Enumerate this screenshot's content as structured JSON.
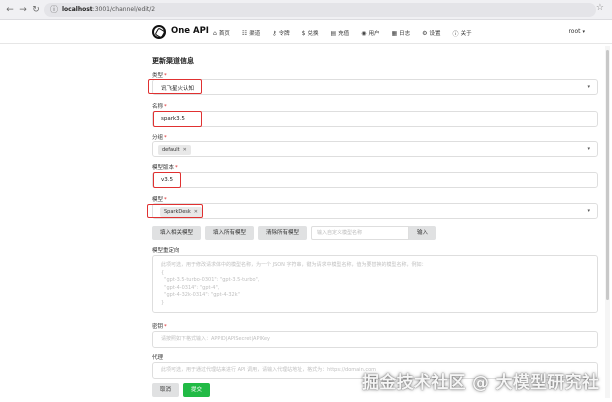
{
  "browser": {
    "url_host": "localhost",
    "url_path": ":3001/channel/edit/2"
  },
  "header": {
    "brand": "One API",
    "menu": [
      {
        "icon": "home-icon",
        "glyph": "⌂",
        "label": "首页"
      },
      {
        "icon": "channel-icon",
        "glyph": "☷",
        "label": "渠道"
      },
      {
        "icon": "token-icon",
        "glyph": "⚷",
        "label": "令牌"
      },
      {
        "icon": "redeem-icon",
        "glyph": "$",
        "label": "兑换"
      },
      {
        "icon": "topup-icon",
        "glyph": "▤",
        "label": "充值"
      },
      {
        "icon": "user-icon",
        "glyph": "◉",
        "label": "用户"
      },
      {
        "icon": "log-icon",
        "glyph": "▦",
        "label": "日志"
      },
      {
        "icon": "settings-icon",
        "glyph": "⚙",
        "label": "设置"
      },
      {
        "icon": "about-icon",
        "glyph": "ⓘ",
        "label": "关于"
      }
    ],
    "user": "root"
  },
  "form": {
    "title": "更新渠道信息",
    "type": {
      "label": "类型",
      "value": "讯飞星火认知"
    },
    "name": {
      "label": "名称",
      "value": "spark3.5"
    },
    "group": {
      "label": "分组",
      "tag": "default"
    },
    "model_version": {
      "label": "模型版本",
      "value": "v3.5"
    },
    "models": {
      "label": "模型",
      "tag": "SparkDesk"
    },
    "model_buttons": {
      "fill_related": "填入相关模型",
      "fill_all": "填入所有模型",
      "clear_all": "清除所有模型",
      "custom_placeholder": "输入自定义模型名称",
      "add": "输入"
    },
    "model_mapping": {
      "label": "模型重定向",
      "placeholder": "此项可选，用于修改请求体中的模型名称，为一个 JSON 字符串，键为请求中模型名称，值为要替换的模型名称，例如：\n{\n  \"gpt-3.5-turbo-0301\": \"gpt-3.5-turbo\",\n  \"gpt-4-0314\": \"gpt-4\",\n  \"gpt-4-32k-0314\": \"gpt-4-32k\"\n}"
    },
    "key": {
      "label": "密钥",
      "placeholder": "请按照如下格式输入：APPID|APISecret|APIKey"
    },
    "proxy": {
      "label": "代理",
      "placeholder": "此项可选，用于通过代理站来进行 API 调用，请输入代理站地址，格式为：https://domain.com"
    },
    "cancel": "取消",
    "submit": "提交"
  },
  "watermark": "掘金技术社区 @ 大模型研究社",
  "colors": {
    "highlight": "#e03131",
    "submit": "#21ba45"
  }
}
